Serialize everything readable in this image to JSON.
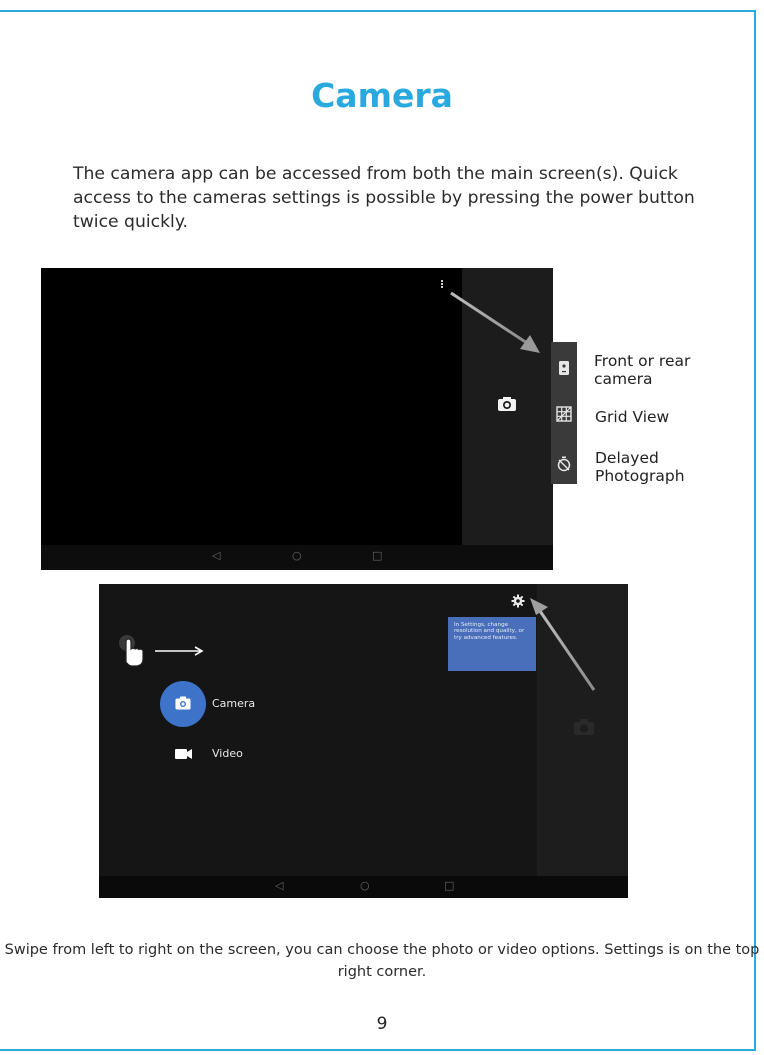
{
  "title": "Camera",
  "intro": "The camera app can be accessed from both the main screen(s). Quick access to the cameras settings is possible by pressing the power button twice quickly.",
  "callouts": {
    "front_rear_line1": "Front or rear",
    "front_rear_line2": "camera",
    "grid_view": "Grid View",
    "delayed_line1": "Delayed",
    "delayed_line2": "Photograph"
  },
  "nav_buttons": {
    "back": "◁",
    "home": "○",
    "recents": "□"
  },
  "mode_menu": {
    "camera": "Camera",
    "video": "Video"
  },
  "settings_tip": "In Settings, change resolution and quality, or try advanced features.",
  "caption": "Swipe from left to right on the screen, you can choose the photo or video options. Settings is on the top right corner.",
  "page_number": "9",
  "colors": {
    "accent": "#2aa9df",
    "tip_bg": "#4a6fba",
    "camera_button": "#3d74c9"
  }
}
